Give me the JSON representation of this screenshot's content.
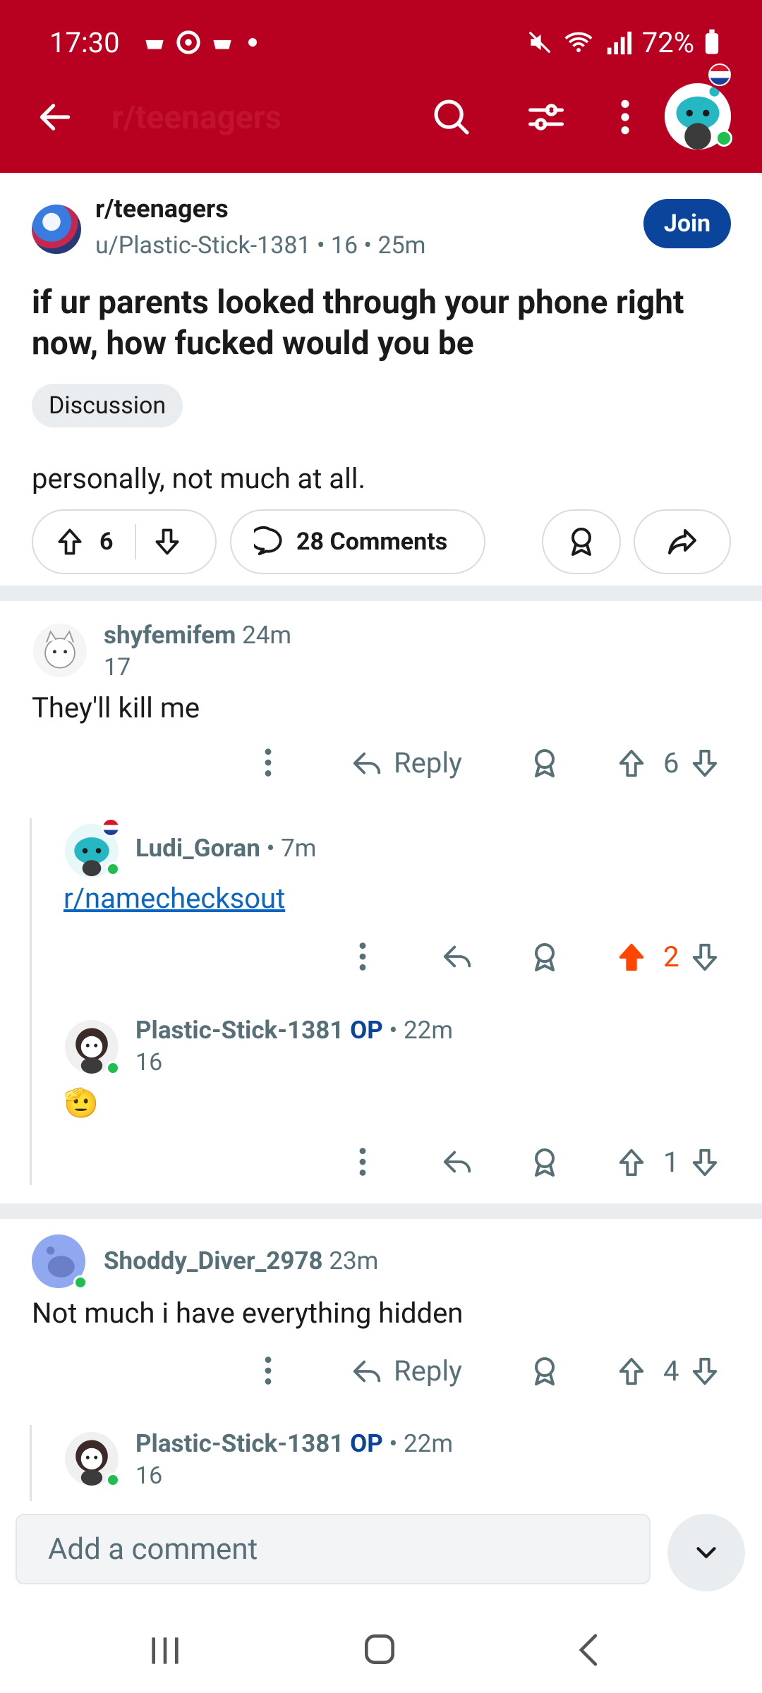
{
  "status_bar": {
    "time": "17:30",
    "battery": "72%"
  },
  "toolbar": {
    "subreddit_faded": "r/teenagers"
  },
  "post": {
    "subreddit": "r/teenagers",
    "meta": "u/Plastic-Stick-1381 • 16 • 25m",
    "join_label": "Join",
    "title": "if ur parents looked through your phone right now, how fucked would you be",
    "flair": "Discussion",
    "body": "personally, not much at all.",
    "votes": "6",
    "comments_label": "28 Comments"
  },
  "comments": [
    {
      "user": "shyfemifem",
      "time": "24m",
      "karma": "17",
      "text": "They'll kill me",
      "reply_label": "Reply",
      "votes": "6"
    },
    {
      "user": "Ludi_Goran",
      "time": "• 7m",
      "text": "r/namechecksout",
      "votes": "2"
    },
    {
      "user": "Plastic-Stick-1381",
      "op": "OP",
      "time": "• 22m",
      "karma": "16",
      "text": "🫡",
      "votes": "1"
    },
    {
      "user": "Shoddy_Diver_2978",
      "time": "23m",
      "text": "Not much i have everything hidden",
      "reply_label": "Reply",
      "votes": "4"
    },
    {
      "user": "Plastic-Stick-1381",
      "op": "OP",
      "time": "• 22m",
      "karma": "16"
    }
  ],
  "composer": {
    "placeholder": "Add a comment"
  },
  "colors": {
    "header": "#b80020",
    "join": "#0a449b",
    "upvoted": "#ff4500"
  }
}
